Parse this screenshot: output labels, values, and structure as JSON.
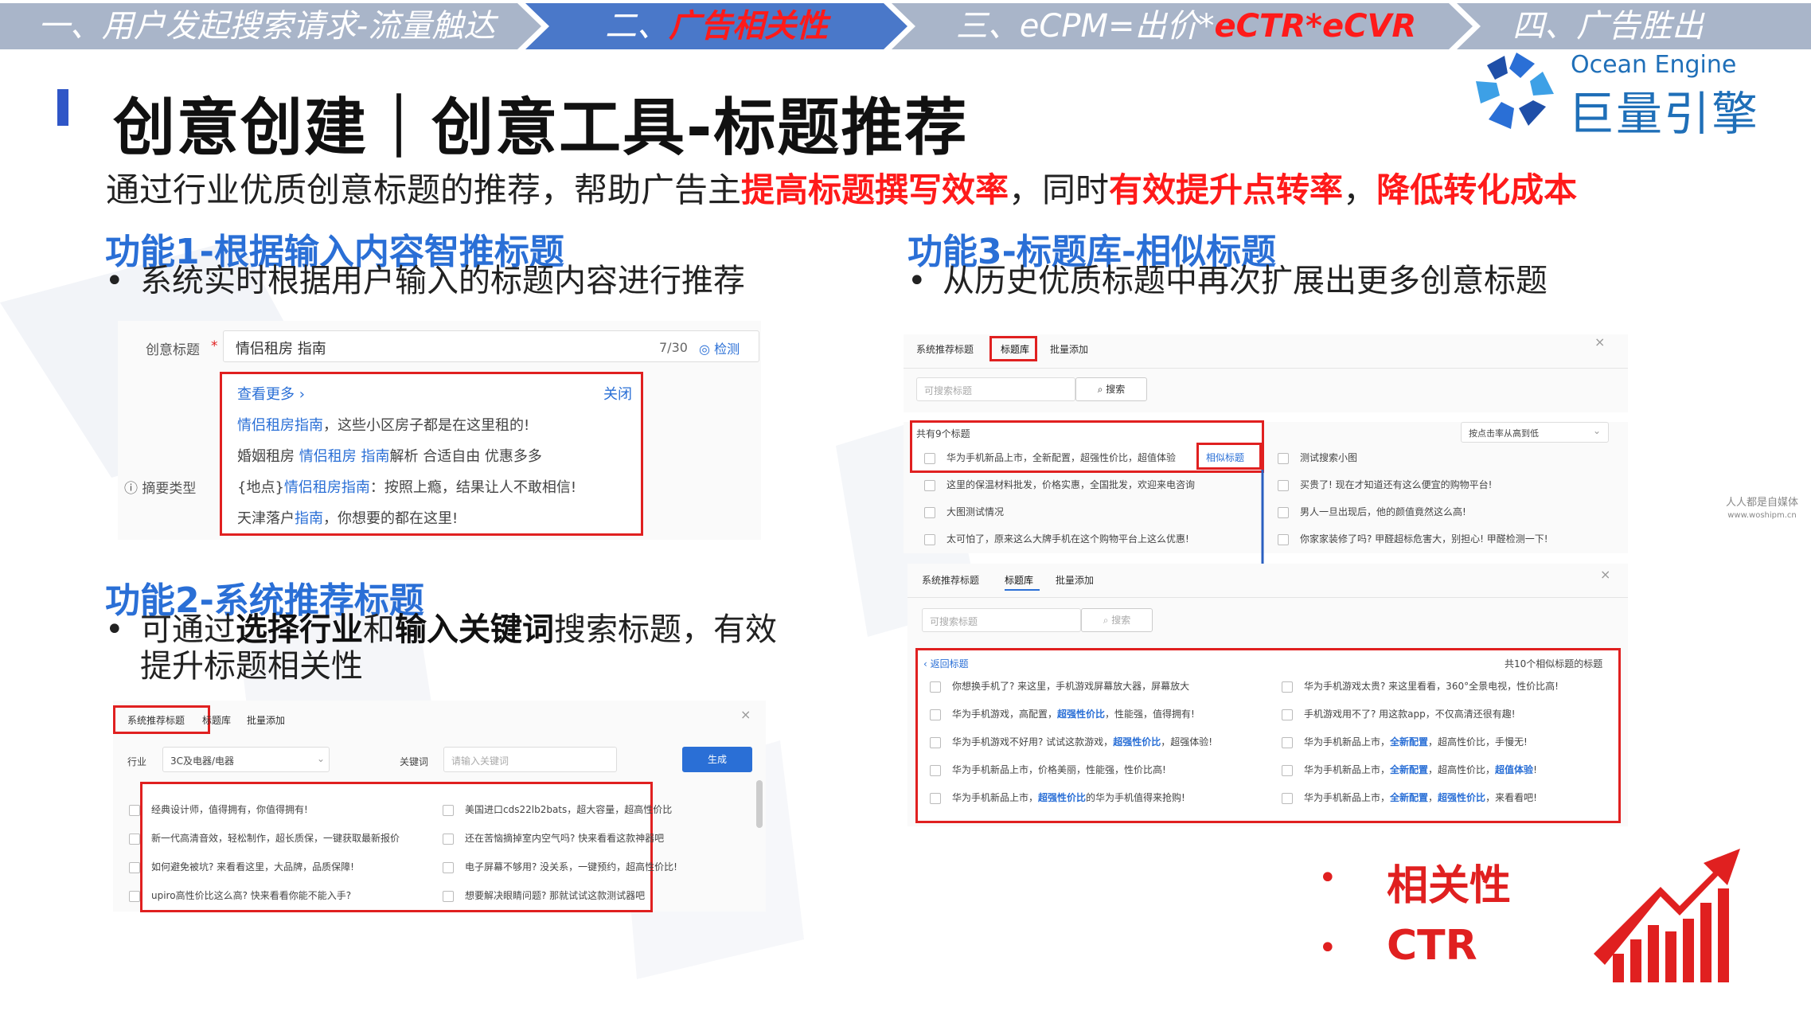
{
  "process_bar": {
    "steps": [
      {
        "label": "一、用户发起搜索请求-流量触达"
      },
      {
        "label_prefix": "二、",
        "label_highlight": "广告相关性"
      },
      {
        "label_prefix": "三、eCPM=出价*",
        "label_highlight": "eCTR*eCVR"
      },
      {
        "label": "四、广告胜出"
      }
    ]
  },
  "logo": {
    "en": "Ocean Engine",
    "cn": "巨量引擎"
  },
  "title": "创意创建｜创意工具-标题推荐",
  "subtitle": {
    "part1": "通过行业优质创意标题的推荐，帮助广告主",
    "hl1": "提高标题撰写效率",
    "part2": "，同时",
    "hl2": "有效提升点转率",
    "part3": "，",
    "hl3": "降低转化成本"
  },
  "feature1": {
    "heading": "功能1-根据输入内容智推标题",
    "bullet": "系统实时根据用户输入的标题内容进行推荐",
    "shot": {
      "label_title": "创意标题",
      "required_mark": "*",
      "input_value": "情侣租房 指南",
      "count": "7/30",
      "detect": "检测",
      "more": "查看更多 ›",
      "close": "关闭",
      "label_summary": "摘要类型",
      "suggestions": [
        {
          "hl": "情侣租房指南",
          "rest": "，这些小区房子都是在这里租的!"
        },
        {
          "pre": "婚姻租房 ",
          "hl": "情侣租房 指南",
          "rest": "解析 合适自由 优惠多多"
        },
        {
          "pre": "{地点}",
          "hl": "情侣租房指南",
          "rest": "：按照上瘾，结果让人不敢相信!"
        },
        {
          "pre": "天津落户",
          "hl": "指南",
          "rest": "，你想要的都在这里!"
        }
      ]
    }
  },
  "feature2": {
    "heading": "功能2-系统推荐标题",
    "bullet_line1_pre": "可通过",
    "bullet_line1_b1": "选择行业",
    "bullet_line1_mid": "和",
    "bullet_line1_b2": "输入关键词",
    "bullet_line1_post": "搜索标题，有效",
    "bullet_line2": "提升标题相关性",
    "shot": {
      "tabs": [
        "系统推荐标题",
        "标题库",
        "批量添加"
      ],
      "industry_label": "行业",
      "industry_value": "3C及电器/电器",
      "keyword_label": "关键词",
      "keyword_placeholder": "请输入关键词",
      "generate": "生成",
      "left": [
        "经典设计师，值得拥有，你值得拥有!",
        "新一代高清音效，轻松制作，超长质保，一键获取最新报价",
        "如何避免被坑? 来看看这里，大品牌，品质保障!",
        "upiro高性价比这么高? 快来看看你能不能入手?"
      ],
      "right": [
        "美国进口cds22lb2bats，超大容量，超高性价比",
        "还在苦恼摘掉室内空气吗? 快来看看这款神器吧",
        "电子屏幕不够用? 没关系，一键预约，超高性价比!",
        "想要解决眼睛问题? 那就试试这款测试器吧"
      ]
    }
  },
  "feature3": {
    "heading": "功能3-标题库-相似标题",
    "bullet": "从历史优质标题中再次扩展出更多创意标题",
    "shot_top": {
      "tabs": [
        "系统推荐标题",
        "标题库",
        "批量添加"
      ],
      "search_placeholder": "可搜索标题",
      "search_btn": "搜索",
      "count_text": "共有9个标题",
      "sort_value": "按点击率从高到低",
      "similar_btn": "相似标题",
      "left": [
        "华为手机新品上市，全新配置，超强性价比，超值体验",
        "这里的保温材料批发，价格实惠，全国批发，欢迎来电咨询",
        "大图测试情况",
        "太可怕了，原来这么大牌手机在这个购物平台上这么优惠!"
      ],
      "right": [
        "测试搜索小图",
        "买贵了! 现在才知道还有这么便宜的购物平台!",
        "男人一旦出现后，他的颜值竟然这么高!",
        "你家家装修了吗? 甲醛超标危害大，别担心! 甲醛检测一下!"
      ]
    },
    "shot_bottom": {
      "tabs": [
        "系统推荐标题",
        "标题库",
        "批量添加"
      ],
      "search_placeholder": "可搜索标题",
      "search_btn": "搜索",
      "back": "‹ 返回标题",
      "count_text": "共10个相似标题的标题",
      "left": [
        {
          "pre": "你想换手机了? 来这里，手机游戏屏幕放大器，屏幕放大"
        },
        {
          "pre": "华为手机游戏，高配置，",
          "hl": "超强性价比",
          "post": "，性能强，值得拥有!"
        },
        {
          "pre": "华为手机游戏不好用? 试试这款游戏，",
          "hl": "超强性价比",
          "post": "，超强体验!"
        },
        {
          "pre": "华为手机新品上市，价格美丽，性能强，性价比高!"
        },
        {
          "pre": "华为手机新品上市，",
          "hl": "超强性价比",
          "post": "的华为手机值得来抢购!"
        }
      ],
      "right": [
        {
          "pre": "华为手机游戏太贵? 来这里看看，360°全景电视，性价比高!"
        },
        {
          "pre": "手机游戏用不了? 用这款app，不仅高清还很有趣!"
        },
        {
          "pre": "华为手机新品上市，",
          "hl": "全新配置",
          "post": "，超高性价比，手慢无!"
        },
        {
          "pre": "华为手机新品上市，",
          "hl": "全新配置",
          "post": "，超高性价比，",
          "hl2": "超值体验",
          "post2": "!"
        },
        {
          "pre": "华为手机新品上市，",
          "hl": "全新配置",
          "post": "，",
          "hl2": "超强性价比",
          "post2": "，来看看吧!"
        }
      ]
    }
  },
  "keypoints": [
    "相关性",
    "CTR"
  ],
  "keypoint_bullet": "•",
  "watermark": {
    "line1": "人人都是自媒体",
    "line2": "www.woshipm.cn"
  },
  "colors": {
    "accent_blue": "#2a6fd6",
    "highlight_red": "#ff1a1a",
    "bar_gray": "#a9b5c9",
    "bar_blue": "#4a78c9"
  }
}
